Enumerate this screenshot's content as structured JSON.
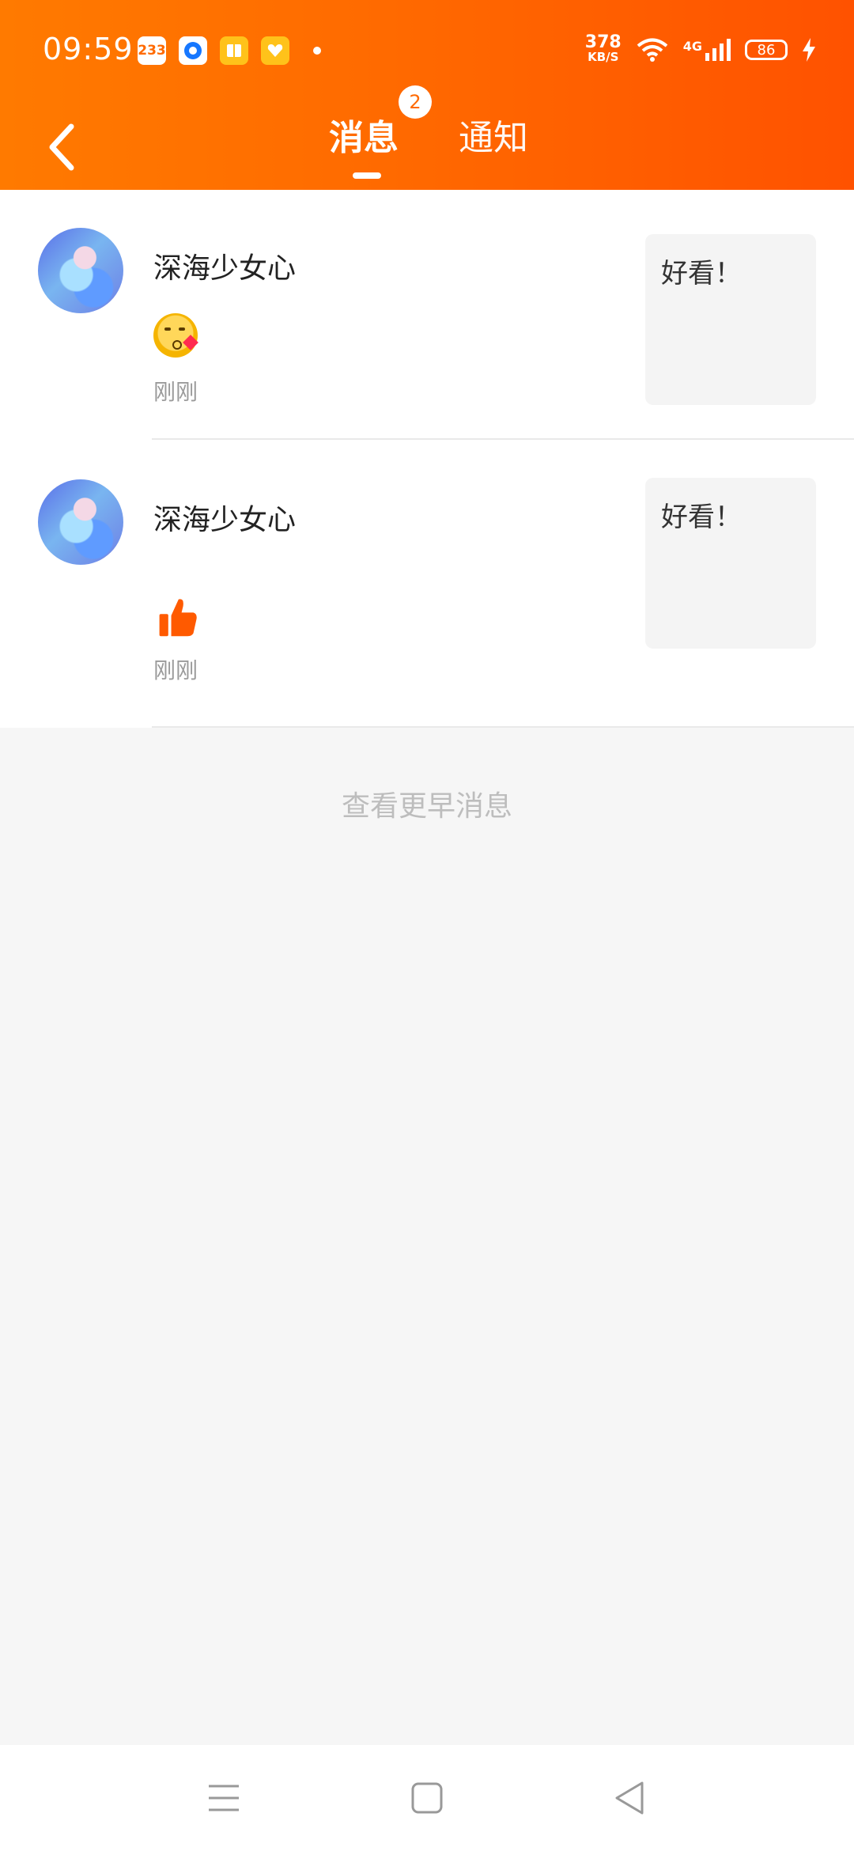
{
  "status_bar": {
    "time": "09:59",
    "notif_app_233": "233",
    "net_speed_value": "378",
    "net_speed_unit": "KB/S",
    "network": "4G",
    "battery": "86"
  },
  "header": {
    "tabs": [
      {
        "label": "消息",
        "badge": "2",
        "active": true
      },
      {
        "label": "通知",
        "active": false
      }
    ],
    "accent_color": "#ff6a00"
  },
  "messages": [
    {
      "username": "深海少女心",
      "reaction_icon": "kiss-emoji",
      "time": "刚刚",
      "preview_text": "好看！"
    },
    {
      "username": "深海少女心",
      "reaction_icon": "thumbs-up",
      "time": "刚刚",
      "preview_text": "好看！"
    }
  ],
  "more_label": "查看更早消息"
}
